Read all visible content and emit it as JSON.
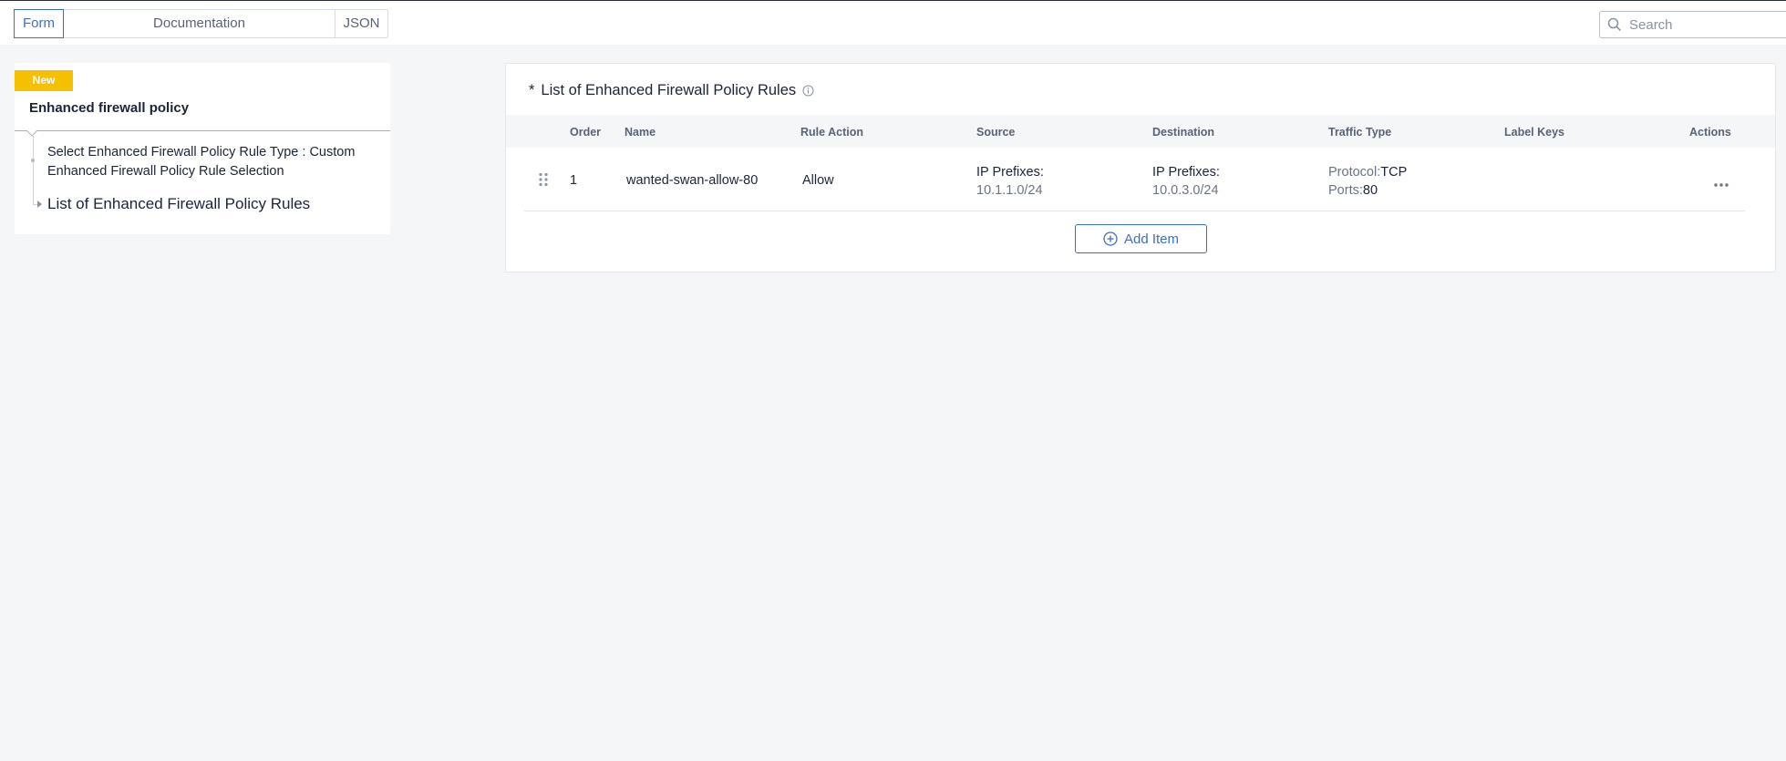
{
  "header": {
    "tabs": [
      {
        "label": "Form",
        "active": true
      },
      {
        "label": "Documentation",
        "active": false
      },
      {
        "label": "JSON",
        "active": false
      }
    ],
    "search": {
      "placeholder": "Search",
      "value": ""
    }
  },
  "sidebar": {
    "badge": "New",
    "title": "Enhanced firewall policy",
    "items": [
      {
        "label": "Select Enhanced Firewall Policy Rule Type : Custom Enhanced Firewall Policy Rule Selection"
      },
      {
        "label": "List of Enhanced Firewall Policy Rules"
      }
    ]
  },
  "main": {
    "required_mark": "*",
    "title": "List of Enhanced Firewall Policy Rules",
    "columns": [
      "Order",
      "Name",
      "Rule Action",
      "Source",
      "Destination",
      "Traffic Type",
      "Label Keys",
      "Actions"
    ],
    "rows": [
      {
        "order": "1",
        "name": "wanted-swan-allow-80",
        "rule_action": "Allow",
        "source_label": "IP Prefixes:",
        "source_value": "10.1.1.0/24",
        "destination_label": "IP Prefixes:",
        "destination_value": "10.0.3.0/24",
        "protocol_label": "Protocol:",
        "protocol_value": "TCP",
        "ports_label": "Ports:",
        "ports_value": "80",
        "label_keys": ""
      }
    ],
    "add_item_label": "Add Item"
  },
  "colors": {
    "accent": "#3c6fc8",
    "badge": "#f5c000",
    "background": "#f5f6f8"
  },
  "icons": [
    "search-icon",
    "info-icon",
    "drag-handle-icon",
    "more-actions-icon",
    "add-circle-icon"
  ]
}
